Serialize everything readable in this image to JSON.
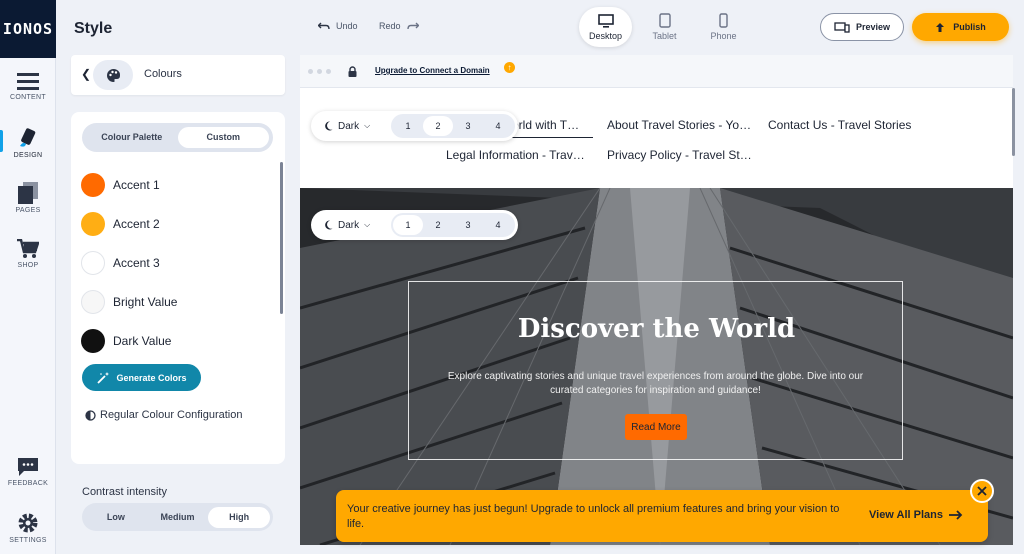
{
  "brand": "IONOS",
  "rail": {
    "content": "CONTENT",
    "design": "DESIGN",
    "pages": "PAGES",
    "shop": "SHOP",
    "feedback": "FEEDBACK",
    "settings": "SETTINGS"
  },
  "topbar": {
    "title": "Style",
    "undo": "Undo",
    "redo": "Redo",
    "devices": {
      "desktop": "Desktop",
      "tablet": "Tablet",
      "phone": "Phone"
    },
    "active_device": "Desktop",
    "preview": "Preview",
    "publish": "Publish"
  },
  "panel": {
    "title": "Colours",
    "tabs": {
      "palette": "Colour Palette",
      "custom": "Custom"
    },
    "active_tab": "Custom",
    "colors": [
      {
        "name": "Accent 1",
        "hex": "#ff6a00"
      },
      {
        "name": "Accent 2",
        "hex": "#ffae14"
      },
      {
        "name": "Accent 3",
        "hex": "#ffffff"
      },
      {
        "name": "Bright Value",
        "hex": "#f7f7f7"
      },
      {
        "name": "Dark Value",
        "hex": "#111111"
      }
    ],
    "generate_label": "Generate Colors",
    "regular_label": "Regular Colour Configuration",
    "contrast": {
      "title": "Contrast intensity",
      "options": [
        "Low",
        "Medium",
        "High"
      ],
      "selected": "High"
    }
  },
  "canvas": {
    "upgrade_link": "Upgrade to Connect a Domain",
    "nav": {
      "item1": "orld with T…",
      "item2": "About Travel Stories - Yo…",
      "item3": "Contact Us - Travel Stories",
      "item4": "Legal Information - Trav…",
      "item5": "Privacy Policy - Travel St…"
    },
    "section_control": {
      "mode": "Dark",
      "numbers": [
        "1",
        "2",
        "3",
        "4"
      ]
    },
    "header_selected": "2",
    "hero_selected": "1",
    "hero": {
      "title": "Discover the World",
      "text": "Explore captivating stories and unique travel experiences from around the globe. Dive into our curated categories for inspiration and guidance!",
      "button": "Read More"
    }
  },
  "promo": {
    "text": "Your creative journey has just begun! Upgrade to unlock all premium features and bring your vision to life.",
    "link": "View All Plans"
  }
}
